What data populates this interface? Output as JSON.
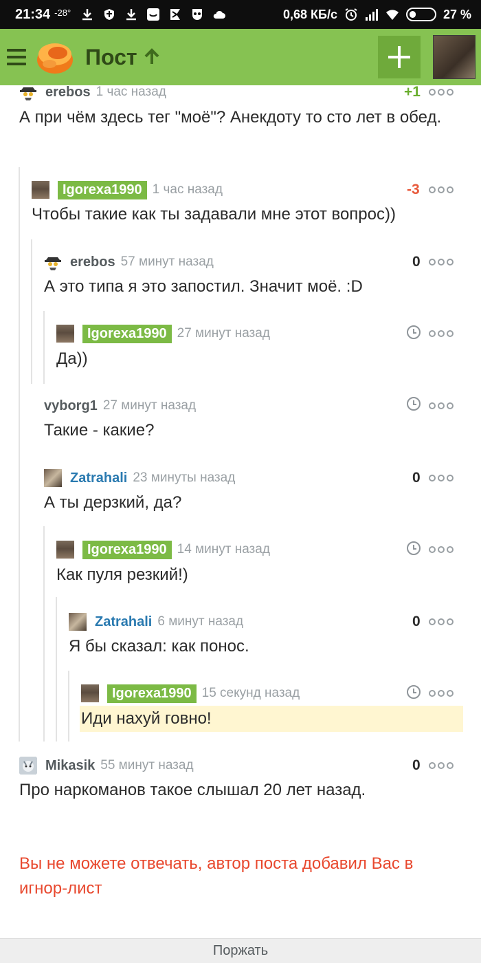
{
  "status_bar": {
    "time": "21:34",
    "temperature": "-28°",
    "network_speed": "0,68 КБ/с",
    "battery": "27 %",
    "battery_level": 0.27
  },
  "appbar": {
    "title": "Пост",
    "icons": [
      "menu-icon",
      "pikabu-logo",
      "arrow-up-icon",
      "plus-icon",
      "avatar"
    ]
  },
  "comments": [
    {
      "author": "erebos",
      "time": "1 час назад",
      "score": "+1",
      "text": "А при чём здесь тег \"моё\"? Анекдоту то сто лет в обед."
    },
    {
      "author": "Igorexa1990",
      "time": "1 час назад",
      "score": "-3",
      "text": "Чтобы такие как ты задавали мне этот вопрос))"
    },
    {
      "author": "erebos",
      "time": "57 минут назад",
      "score": "0",
      "text": "А это типа я это запостил. Значит моё. :D"
    },
    {
      "author": "Igorexa1990",
      "time": "27 минут назад",
      "score": "",
      "text": "Да))"
    },
    {
      "author": "vyborg1",
      "time": "27 минут назад",
      "score": "",
      "text": "Такие - какие?"
    },
    {
      "author": "Zatrahali",
      "time": "23 минуты назад",
      "score": "0",
      "text": "А ты дерзкий, да?"
    },
    {
      "author": "Igorexa1990",
      "time": "14 минут назад",
      "score": "",
      "text": "Как пуля резкий!)"
    },
    {
      "author": "Zatrahali",
      "time": "6 минут назад",
      "score": "0",
      "text": "Я бы сказал: как понос."
    },
    {
      "author": "Igorexa1990",
      "time": "15 секунд назад",
      "score": "",
      "text": "Иди нахуй говно!"
    },
    {
      "author": "Mikasik",
      "time": "55 минут назад",
      "score": "0",
      "text": "Про наркоманов такое слышал 20 лет назад."
    }
  ],
  "warning": "Вы не можете отвечать, автор поста добавил Вас в игнор-лист",
  "bottom_bar": {
    "label": "Поржать"
  },
  "colors": {
    "appbar": "#86c252",
    "author_badge": "#7cba45",
    "positive": "#6aae2f",
    "negative": "#e85a3c",
    "warning": "#e8482e",
    "highlight": "#fff6d1",
    "link_blue": "#2a7ab0"
  }
}
